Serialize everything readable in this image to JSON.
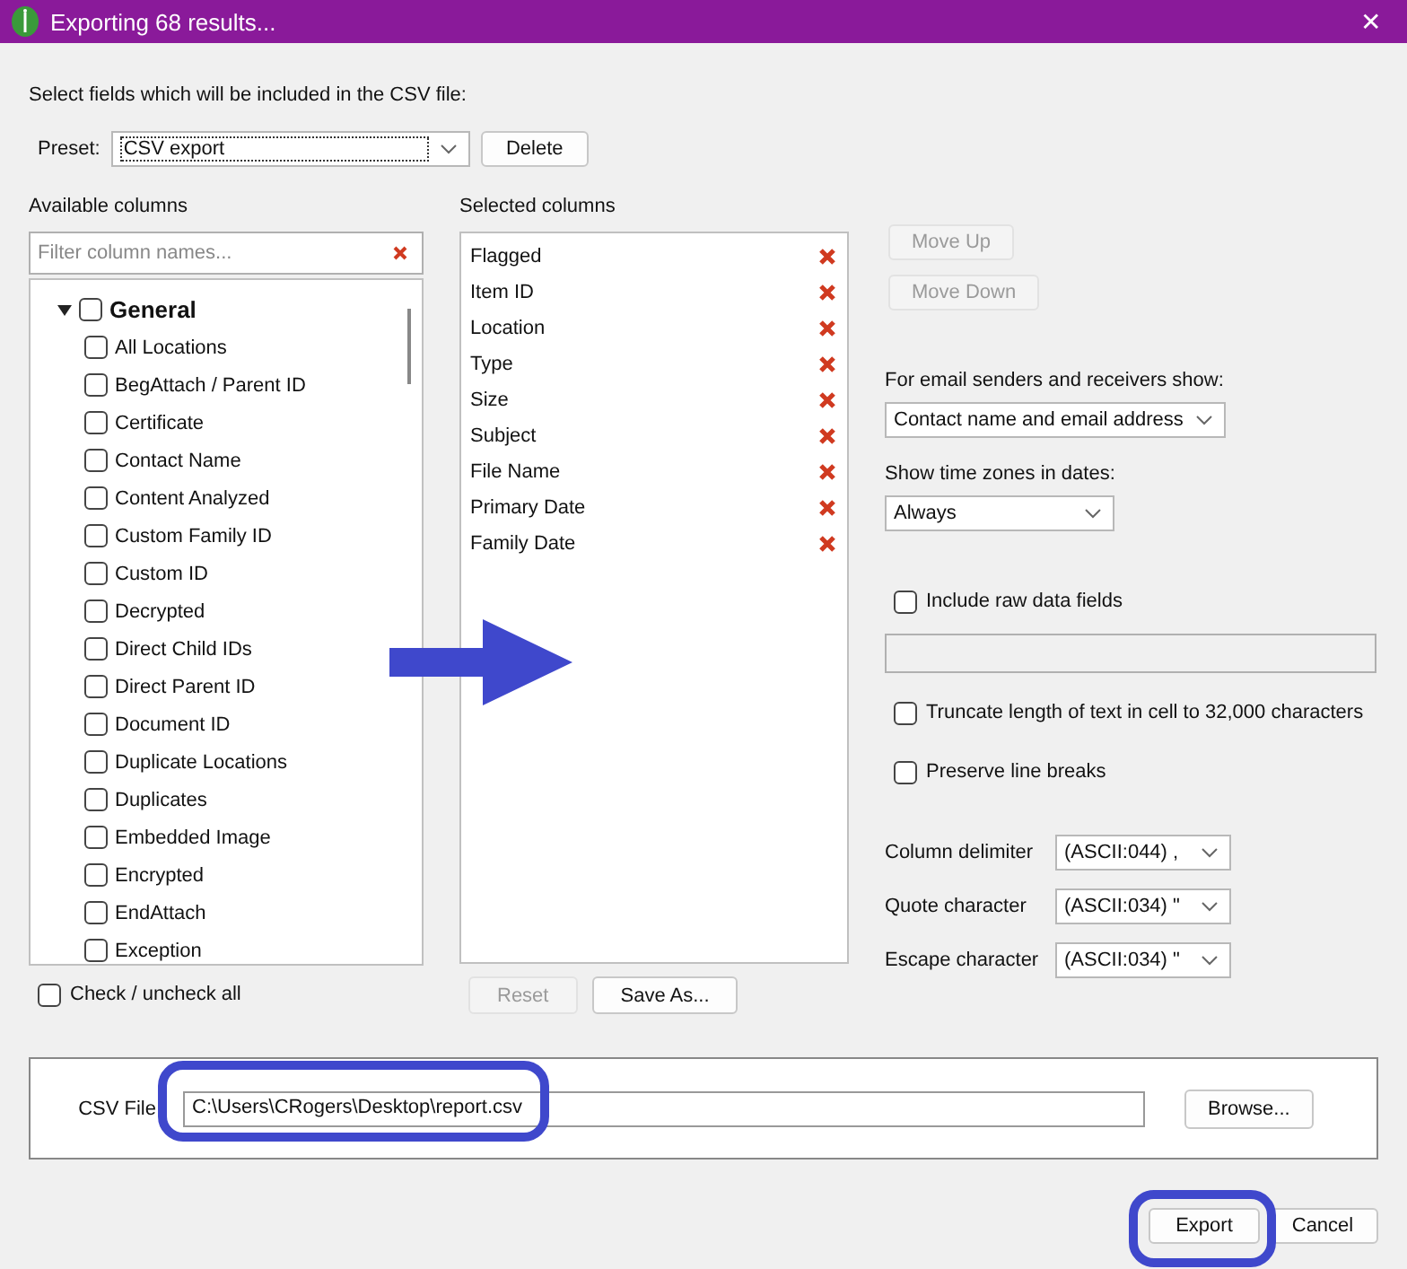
{
  "window": {
    "title": "Exporting 68 results...",
    "close": "✕"
  },
  "instruction": "Select fields which will be included in the CSV file:",
  "preset": {
    "label": "Preset:",
    "value": "CSV export",
    "delete_button": "Delete"
  },
  "available": {
    "label": "Available columns",
    "filter_placeholder": "Filter column names...",
    "tree": [
      {
        "label": "General",
        "checked": false,
        "expanded": true,
        "children": [
          {
            "label": "All Locations",
            "checked": false
          },
          {
            "label": "BegAttach / Parent ID",
            "checked": false
          },
          {
            "label": "Certificate",
            "checked": false
          },
          {
            "label": "Contact Name",
            "checked": false
          },
          {
            "label": "Content Analyzed",
            "checked": false
          },
          {
            "label": "Custom Family ID",
            "checked": false
          },
          {
            "label": "Custom ID",
            "checked": false
          },
          {
            "label": "Decrypted",
            "checked": false
          },
          {
            "label": "Direct Child IDs",
            "checked": false
          },
          {
            "label": "Direct Parent ID",
            "checked": false
          },
          {
            "label": "Document ID",
            "checked": false
          },
          {
            "label": "Duplicate Locations",
            "checked": false
          },
          {
            "label": "Duplicates",
            "checked": false
          },
          {
            "label": "Embedded Image",
            "checked": false
          },
          {
            "label": "Encrypted",
            "checked": false
          },
          {
            "label": "EndAttach",
            "checked": false
          },
          {
            "label": "Exception",
            "checked": false
          }
        ]
      }
    ],
    "check_all": {
      "label": "Check / uncheck all",
      "checked": false
    }
  },
  "selected": {
    "label": "Selected columns",
    "items": [
      "Flagged",
      "Item ID",
      "Location",
      "Type",
      "Size",
      "Subject",
      "File Name",
      "Primary Date",
      "Family Date"
    ],
    "buttons": [
      {
        "label": "Reset",
        "disabled": true
      },
      {
        "label": "Save As...",
        "disabled": false
      }
    ]
  },
  "move_buttons": [
    {
      "label": "Move Up",
      "disabled": true
    },
    {
      "label": "Move Down",
      "disabled": true
    }
  ],
  "email_show": {
    "label": "For email senders and receivers show:",
    "value": "Contact name and email address"
  },
  "time_zones": {
    "label": "Show time zones in dates:",
    "value": "Always"
  },
  "raw_data": {
    "label": "Include raw data fields",
    "checked": false
  },
  "truncate": {
    "label": "Truncate length of text in cell to 32,000 characters",
    "checked": false
  },
  "line_breaks": {
    "label": "Preserve line breaks",
    "checked": false
  },
  "delimiters": [
    {
      "label": "Column delimiter",
      "value": "(ASCII:044) ,"
    },
    {
      "label": "Quote character",
      "value": "(ASCII:034) \""
    },
    {
      "label": "Escape character",
      "value": "(ASCII:034) \""
    }
  ],
  "csv_file": {
    "label": "CSV File",
    "value": "C:\\Users\\CRogers\\Desktop\\report.csv",
    "browse_button": "Browse..."
  },
  "footer_buttons": [
    "Export",
    "Cancel"
  ]
}
